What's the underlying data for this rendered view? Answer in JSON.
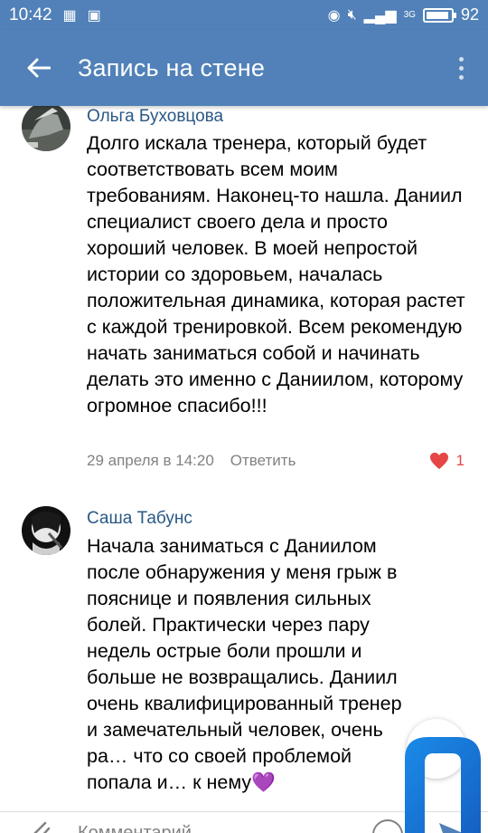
{
  "status_bar": {
    "time": "10:42",
    "network": "3G",
    "battery_percent": "92",
    "battery_level": 0.92
  },
  "header": {
    "title": "Запись на стене"
  },
  "comments": [
    {
      "author": "Ольга Буховцова",
      "text": "Долго искала тренера, который будет соответствовать всем моим требованиям. Наконец-то нашла. Даниил специалист своего дела и просто хороший человек. В моей непростой истории со здоровьем, началась положительная динамика, которая растет с каждой тренировкой. Всем рекомендую начать заниматься собой и начинать делать это именно с Даниилом, которому огромное спасибо!!!",
      "date": "29 апреля в 14:20",
      "reply_label": "Ответить",
      "likes": "1"
    },
    {
      "author": "Саша Табунс",
      "text": "Начала заниматься с Даниилом после обнаружения у меня грыж в пояснице и появления сильных болей. Практически через пару недель острые боли прошли и больше не возвращались. Даниил очень квалифицированный тренер и замечательный человек, очень ра… что со своей проблемой попала и… к нему💜"
    }
  ],
  "input": {
    "placeholder": "Комментарий..."
  },
  "colors": {
    "brand": "#5181b8",
    "author_link": "#2a5885",
    "like": "#e64646",
    "muted": "#828282"
  },
  "icons": [
    "back-arrow-icon",
    "more-vert-icon",
    "heart-icon",
    "attach-icon",
    "emoji-icon",
    "send-icon",
    "chevron-down-icon"
  ]
}
